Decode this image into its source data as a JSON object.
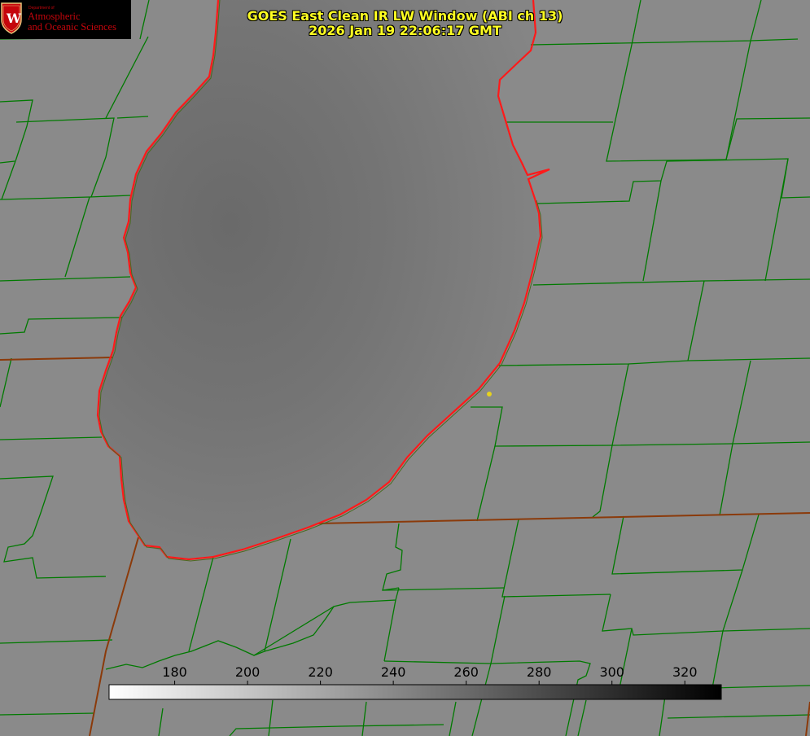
{
  "title": {
    "line1": "GOES East Clean IR LW Window (ABI ch 13)",
    "line2": "2026 Jan 19 22:06:17 GMT"
  },
  "logo": {
    "department": "Department of",
    "line1": "Atmospheric",
    "line2": "and Oceanic Sciences",
    "mark": "W"
  },
  "colorbar": {
    "min": 162,
    "max": 330,
    "ticks": [
      "180",
      "200",
      "220",
      "240",
      "260",
      "280",
      "300",
      "320"
    ],
    "colormap": "grayscale, white at low values to black at high values"
  },
  "colors": {
    "land": "#8a8a8a",
    "lake_darker": "#6e6e6e",
    "county_lines": "#007a00",
    "state_lines": "#8b3a0a",
    "coastline": "#ff1a1a",
    "title_text": "#ffff22",
    "marker": "#e6d21e"
  },
  "features": {
    "water_body": "lake",
    "marker": "yellow-dot"
  }
}
